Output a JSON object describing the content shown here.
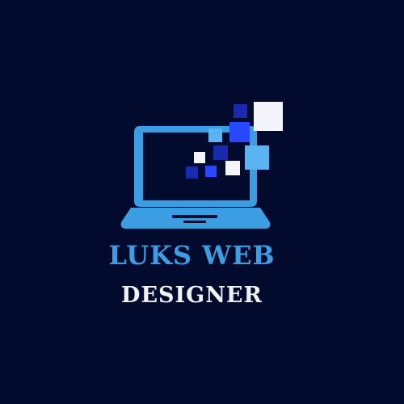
{
  "logo": {
    "title": "LUKS WEB",
    "subtitle": "DESIGNER",
    "icon": "laptop-pixel-icon"
  },
  "colors": {
    "background": "#020b2e",
    "laptop": "#3d9de3",
    "title": "#3d9de3",
    "subtitle": "#f1f2f6",
    "pixel_dark": "#1a2ab0",
    "pixel_bright": "#2848ff",
    "pixel_light": "#5ab4f2",
    "pixel_white": "#f4f5fa"
  }
}
